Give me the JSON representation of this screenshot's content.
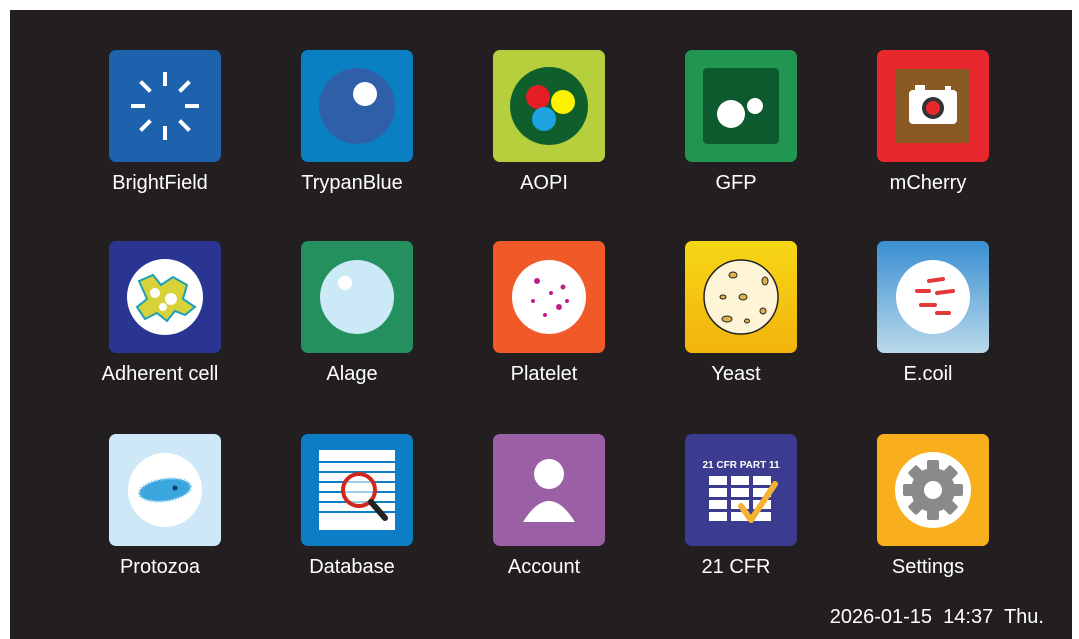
{
  "apps": [
    {
      "label": "BrightField",
      "icon": "brightfield-icon",
      "color": "#1e62ad"
    },
    {
      "label": "TrypanBlue",
      "icon": "trypan-blue-icon",
      "color": "#0a7fc2"
    },
    {
      "label": "AOPI",
      "icon": "aopi-icon",
      "color": "#b6cf3d"
    },
    {
      "label": "GFP",
      "icon": "gfp-icon",
      "color": "#219653"
    },
    {
      "label": "mCherry",
      "icon": "mcherry-camera-icon",
      "color": "#e8282e"
    },
    {
      "label": "Adherent cell",
      "icon": "adherent-cell-icon",
      "color": "#2a3591"
    },
    {
      "label": "Alage",
      "icon": "alage-icon",
      "color": "#23905e"
    },
    {
      "label": "Platelet",
      "icon": "platelet-icon",
      "color": "#f05a28"
    },
    {
      "label": "Yeast",
      "icon": "yeast-icon",
      "color": "#f7d716"
    },
    {
      "label": "E.coil",
      "icon": "ecoli-icon",
      "color": "#3a8fd1"
    },
    {
      "label": "Protozoa",
      "icon": "protozoa-icon",
      "color": "#cfe8f7"
    },
    {
      "label": "Database",
      "icon": "database-search-icon",
      "color": "#0d7dc6"
    },
    {
      "label": "Account",
      "icon": "account-user-icon",
      "color": "#9b5fa6"
    },
    {
      "label": "21 CFR",
      "icon": "cfr-checklist-icon",
      "color": "#3b3c8f",
      "badge": "21 CFR PART 11"
    },
    {
      "label": "Settings",
      "icon": "settings-gear-icon",
      "color": "#f9ae1e"
    }
  ],
  "status": {
    "date": "2026-01-15",
    "time": "14:37",
    "day": "Thu."
  }
}
